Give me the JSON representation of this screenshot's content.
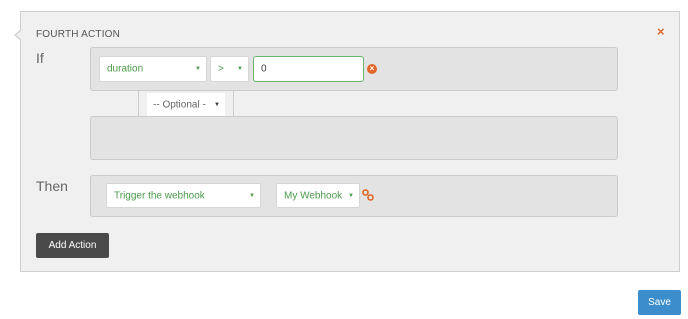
{
  "action": {
    "title": "FOURTH ACTION",
    "close_symbol": "×",
    "if_label": "If",
    "then_label": "Then",
    "condition": {
      "field": "duration",
      "operator": ">",
      "value": "0",
      "remove_symbol": "×"
    },
    "optional_select": "-- Optional -",
    "then": {
      "action_type": "Trigger the webhook",
      "webhook": "My Webhook"
    },
    "dropdown_arrow": "▼"
  },
  "buttons": {
    "add_action": "Add Action",
    "save": "Save"
  },
  "colors": {
    "accent_green": "#4a9a4a",
    "danger_orange": "#e0672a",
    "save_blue": "#3c8dcc",
    "dark_button": "#4a4a4a"
  },
  "icons": {
    "close": "close-icon",
    "remove": "remove-circle-icon",
    "link": "link-icon",
    "dropdown": "caret-down-icon"
  }
}
